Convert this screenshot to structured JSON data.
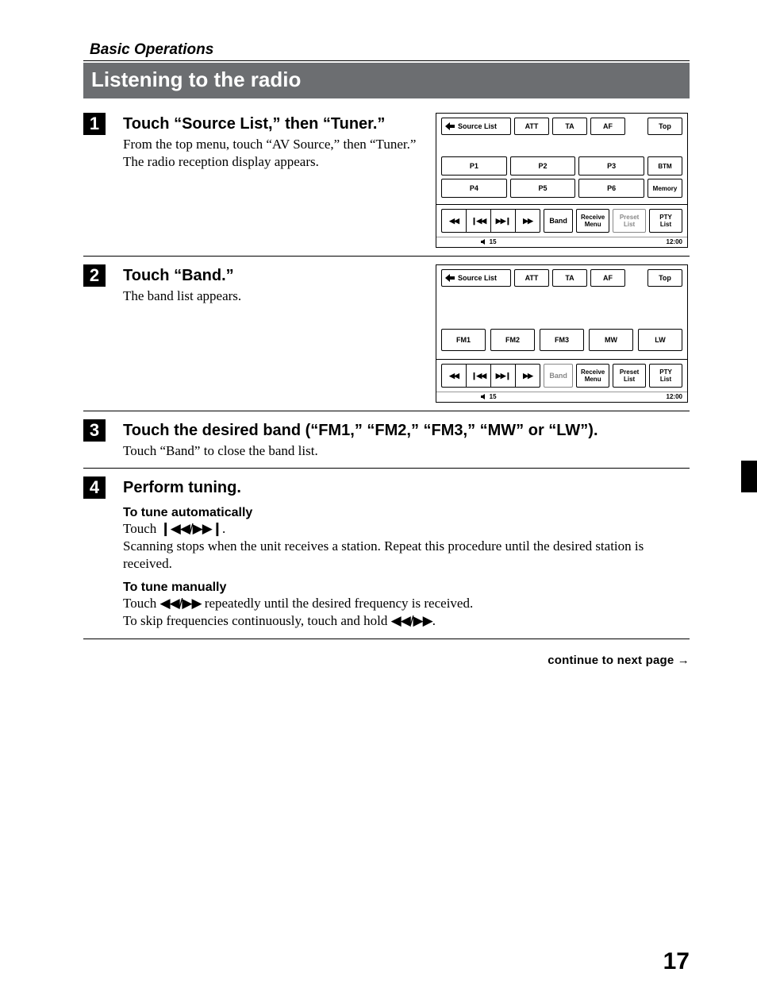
{
  "header": {
    "basic_ops": "Basic Operations",
    "section_title": "Listening to the radio"
  },
  "steps": {
    "s1": {
      "num": "1",
      "heading": "Touch “Source List,” then “Tuner.”",
      "line1": "From the top menu, touch “AV Source,” then “Tuner.”",
      "line2": "The radio reception display appears."
    },
    "s2": {
      "num": "2",
      "heading": "Touch “Band.”",
      "line1": "The band list appears."
    },
    "s3": {
      "num": "3",
      "heading": "Touch the desired band (“FM1,” “FM2,” “FM3,” “MW” or “LW”).",
      "line1": "Touch “Band” to close the band list."
    },
    "s4": {
      "num": "4",
      "heading": "Perform tuning.",
      "auto_h": "To tune automatically",
      "auto_l1a": "Touch ",
      "auto_l1b": ".",
      "auto_l2": "Scanning stops when the unit receives a station. Repeat this procedure until the desired station is received.",
      "man_h": "To tune manually",
      "man_l1a": "Touch ",
      "man_l1b": " repeatedly until the desired frequency is received.",
      "man_l2a": "To skip frequencies continuously, touch and hold ",
      "man_l2b": "."
    }
  },
  "glyphs": {
    "seek": "❙◀◀/▶▶❙",
    "manual": "◀◀/▶▶",
    "rew": "◀◀",
    "prev": "❙◀◀",
    "next": "▶▶❙",
    "fwd": "▶▶",
    "arrow_right": "→"
  },
  "shot": {
    "source_list": "Source List",
    "att": "ATT",
    "ta": "TA",
    "af": "AF",
    "top": "Top",
    "p1": "P1",
    "p2": "P2",
    "p3": "P3",
    "p4": "P4",
    "p5": "P5",
    "p6": "P6",
    "btm": "BTM",
    "memory": "Memory",
    "band": "Band",
    "receive_menu_1": "Receive",
    "receive_menu_2": "Menu",
    "preset_list_1": "Preset",
    "preset_list_2": "List",
    "pty_list_1": "PTY",
    "pty_list_2": "List",
    "vol": "15",
    "clock": "12:00",
    "fm1": "FM1",
    "fm2": "FM2",
    "fm3": "FM3",
    "mw": "MW",
    "lw": "LW"
  },
  "footer": {
    "continue": "continue to next page",
    "page_num": "17"
  }
}
